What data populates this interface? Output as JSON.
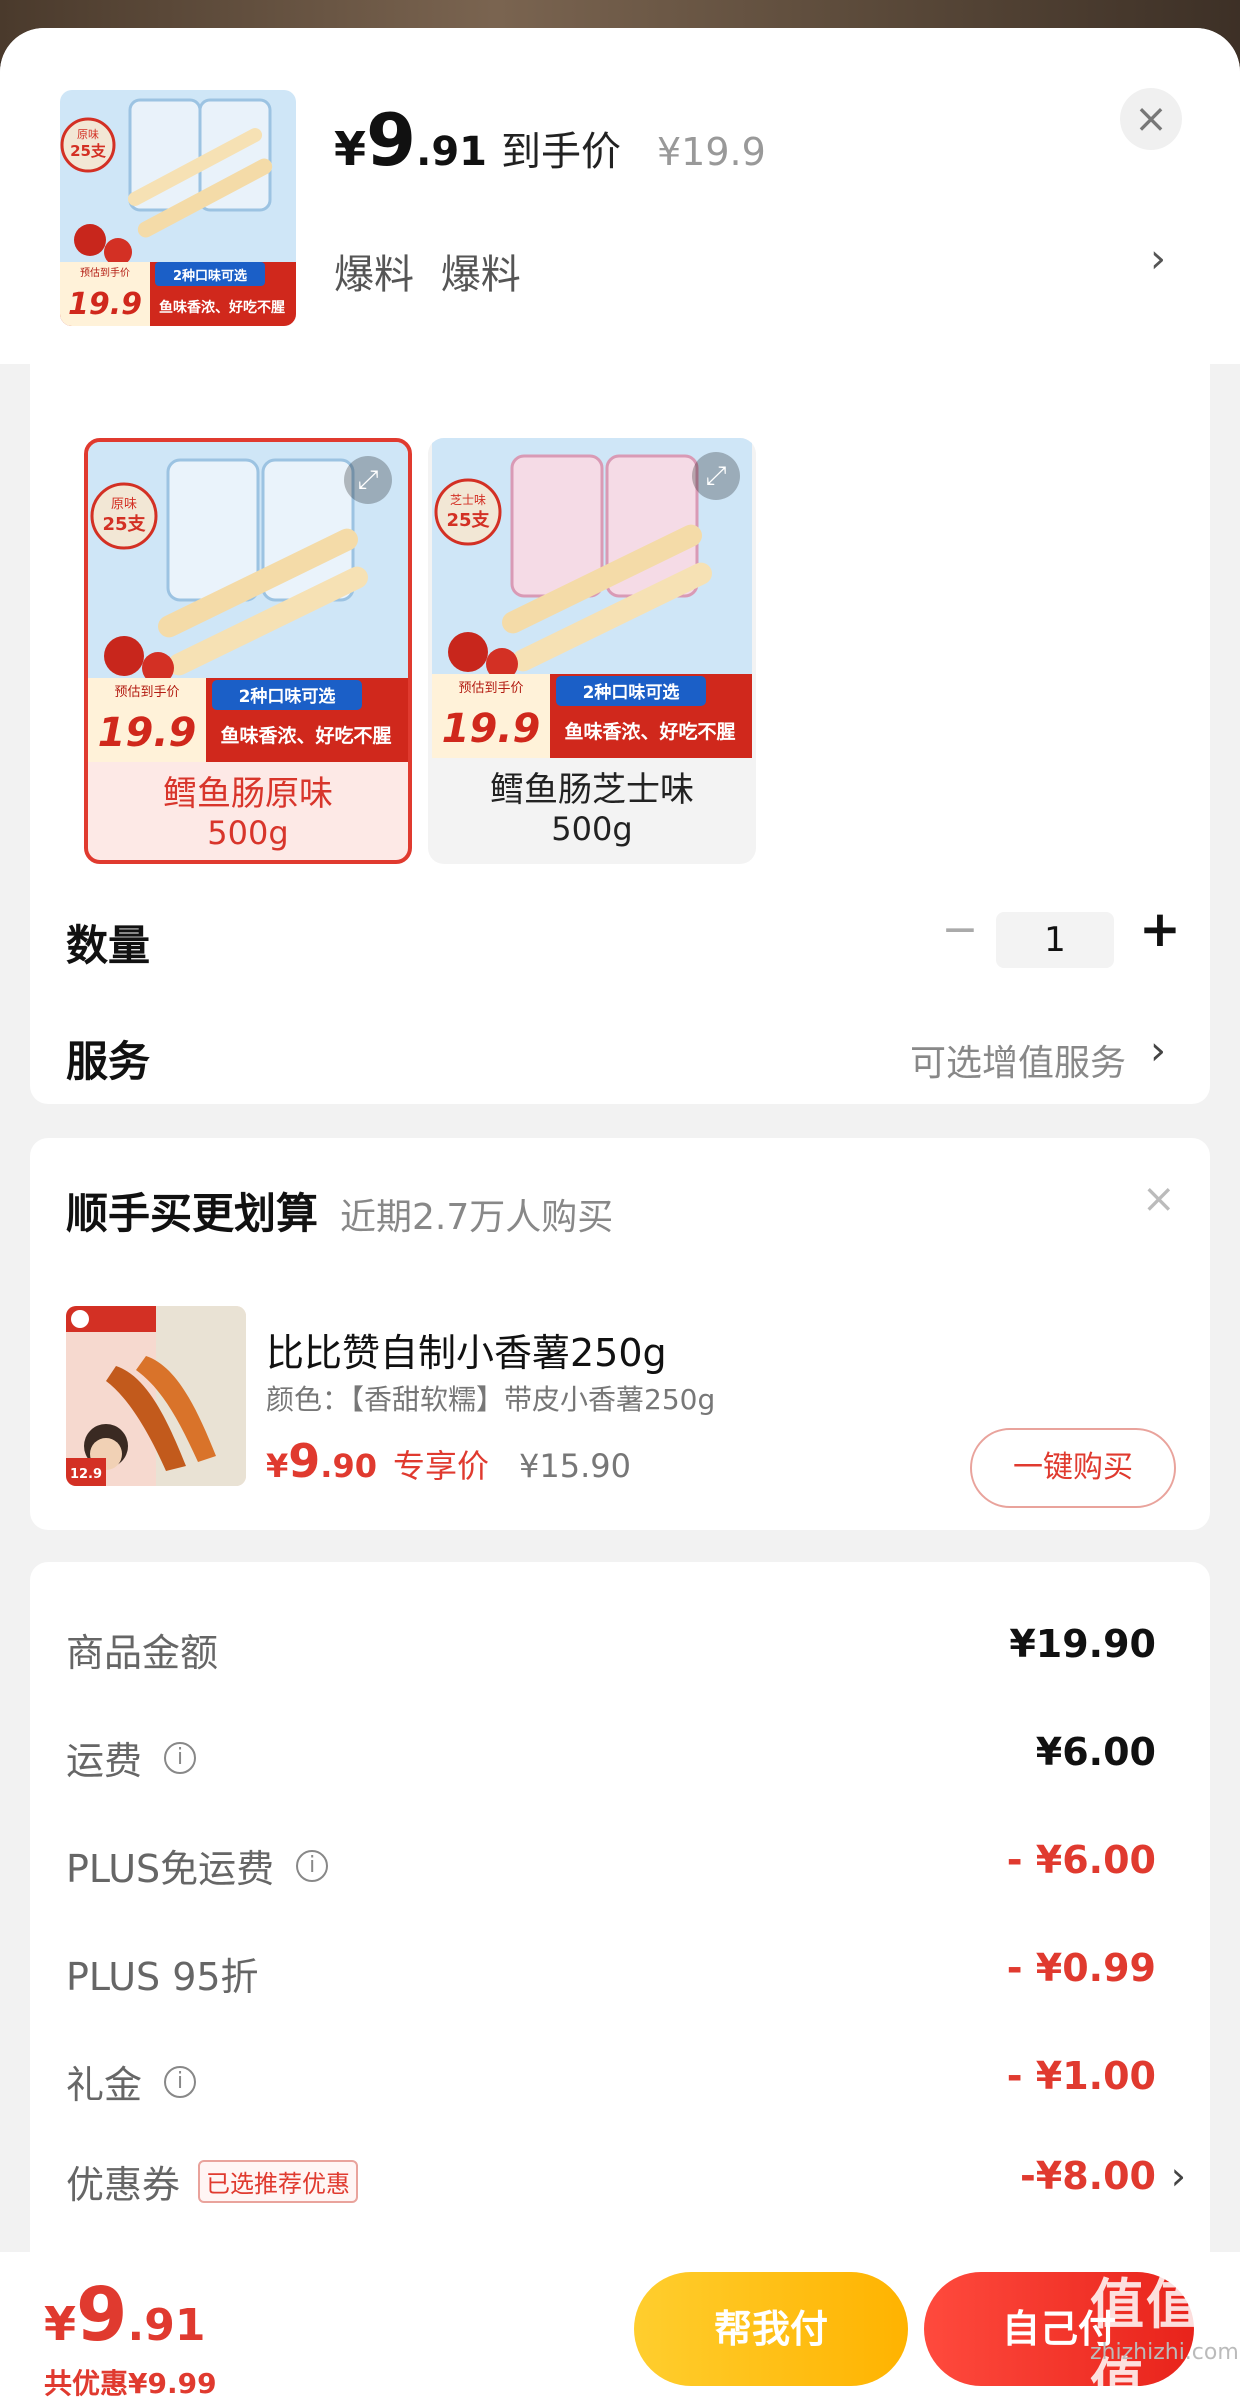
{
  "header": {
    "price_symbol": "¥",
    "price_int": "9",
    "price_dec": ".91",
    "price_tag": "到手价",
    "original_price": "¥19.9",
    "breaking_news": "爆料 爆料",
    "chevron": "›",
    "close": "×"
  },
  "product_image": {
    "badge_top": "原味",
    "badge_count": "25支",
    "promo_label": "预估到手价",
    "promo_price": "19.9",
    "promo_line1": "2种口味可选",
    "promo_line2": "鱼味香浓、好吃不腥"
  },
  "variants": [
    {
      "name": "鳕鱼肠原味",
      "size": "500g",
      "badge_top": "原味",
      "badge_count": "25支",
      "selected": true
    },
    {
      "name": "鳕鱼肠芝士味",
      "size": "500g",
      "badge_top": "芝士味",
      "badge_count": "25支",
      "selected": false
    }
  ],
  "quantity": {
    "label": "数量",
    "minus": "−",
    "value": "1",
    "plus": "+"
  },
  "service": {
    "label": "服务",
    "value": "可选增值服务",
    "chevron": "›"
  },
  "addon": {
    "title": "顺手买更划算",
    "subtitle": "近期2.7万人购买",
    "close": "×",
    "item": {
      "name": "比比赞自制小香薯250g",
      "spec": "颜色：【香甜软糯】带皮小香薯250g",
      "price_symbol": "¥",
      "price_int": "9",
      "price_dec": ".90",
      "price_tag": "专享价",
      "original_price": "¥15.90",
      "image_price": "12.9",
      "buy_label": "一键购买"
    }
  },
  "summary": {
    "rows": [
      {
        "label": "商品金额",
        "value": "¥19.90",
        "info": false,
        "red": false
      },
      {
        "label": "运费",
        "value": "¥6.00",
        "info": true,
        "red": false
      },
      {
        "label": "PLUS免运费",
        "value": "- ¥6.00",
        "info": true,
        "red": true
      },
      {
        "label": "PLUS 95折",
        "value": "- ¥0.99",
        "info": false,
        "red": true
      },
      {
        "label": "礼金",
        "value": "- ¥1.00",
        "info": true,
        "red": true
      },
      {
        "label": "优惠券",
        "value": "-¥8.00",
        "info": false,
        "red": true,
        "badge": "已选推荐优惠",
        "chevron": "›"
      }
    ],
    "info_glyph": "i"
  },
  "bottom_bar": {
    "price_symbol": "¥",
    "price_int": "9",
    "price_dec": ".91",
    "discount_text": "共优惠¥9.99",
    "help_pay_label": "帮我付",
    "self_pay_label": "自己付"
  },
  "watermark": {
    "main": "值值值",
    "sub": "zhizhizhi.com"
  },
  "colors": {
    "accent_red": "#e03a2f",
    "help_button": "#ffb300",
    "pay_button": "#e8231b"
  }
}
